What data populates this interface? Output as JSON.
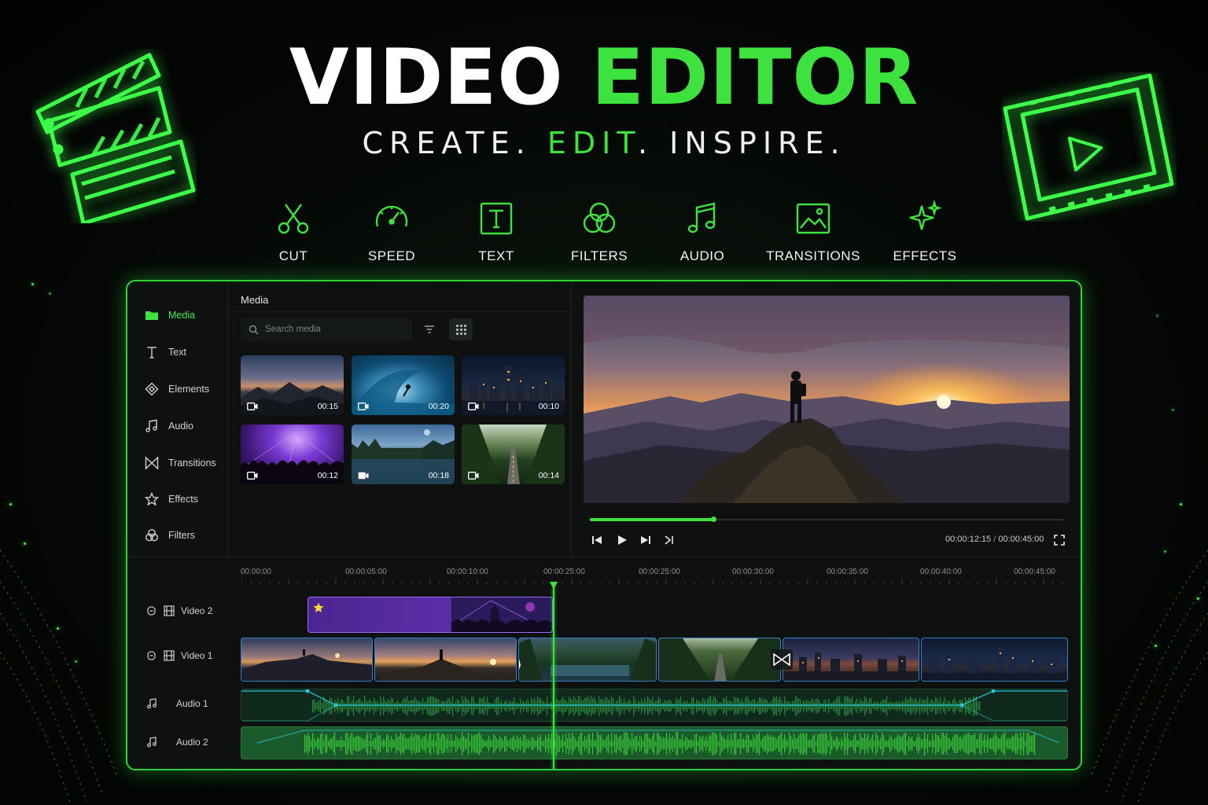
{
  "hero": {
    "title_white": "VIDEO",
    "title_green": "EDITOR",
    "tagline": {
      "part1": "CREATE.",
      "part2": "EDIT",
      "part3": ". INSPIRE."
    }
  },
  "features": [
    {
      "label": "CUT",
      "icon": "scissors-icon"
    },
    {
      "label": "SPEED",
      "icon": "speedometer-icon"
    },
    {
      "label": "TEXT",
      "icon": "text-box-icon"
    },
    {
      "label": "FILTERS",
      "icon": "filters-icon"
    },
    {
      "label": "AUDIO",
      "icon": "music-note-icon"
    },
    {
      "label": "TRANSITIONS",
      "icon": "image-icon"
    },
    {
      "label": "EFFECTS",
      "icon": "sparkle-icon"
    }
  ],
  "sidebar": {
    "items": [
      {
        "label": "Media",
        "icon": "folder-icon",
        "active": true
      },
      {
        "label": "Text",
        "icon": "text-icon"
      },
      {
        "label": "Elements",
        "icon": "diamond-icon"
      },
      {
        "label": "Audio",
        "icon": "music-icon"
      },
      {
        "label": "Transitions",
        "icon": "bowtie-icon"
      },
      {
        "label": "Effects",
        "icon": "star-icon"
      },
      {
        "label": "Filters",
        "icon": "circles-icon"
      }
    ]
  },
  "media": {
    "title": "Media",
    "search_placeholder": "Search media",
    "thumbnails": [
      {
        "duration": "00:15",
        "scene": "mountain-dusk"
      },
      {
        "duration": "00:20",
        "scene": "surfer-wave"
      },
      {
        "duration": "00:10",
        "scene": "city-night"
      },
      {
        "duration": "00:12",
        "scene": "concert-crowd"
      },
      {
        "duration": "00:18",
        "scene": "lake-forest"
      },
      {
        "duration": "00:14",
        "scene": "forest-road"
      }
    ]
  },
  "player": {
    "current_time": "00:00:12:15",
    "separator": "/",
    "total_time": "00:00:45:00",
    "progress": 0.26
  },
  "timeline": {
    "ruler": [
      "00:00:00",
      "00:00:05:00",
      "00:00:10:00",
      "00:00:25:00",
      "00:00:25:00",
      "00:00:30:00",
      "00:00:35:00",
      "00:00:40:00",
      "00:00:45:00"
    ],
    "tracks": [
      {
        "label": "Video 2"
      },
      {
        "label": "Video 1"
      },
      {
        "label": "Audio 1"
      },
      {
        "label": "Audio 2"
      }
    ]
  },
  "colors": {
    "accent": "#3ee23e",
    "panel_bg": "#0e1110",
    "clip_purple": "#5b2ea6",
    "clip_border_blue": "#3a7fc4"
  }
}
